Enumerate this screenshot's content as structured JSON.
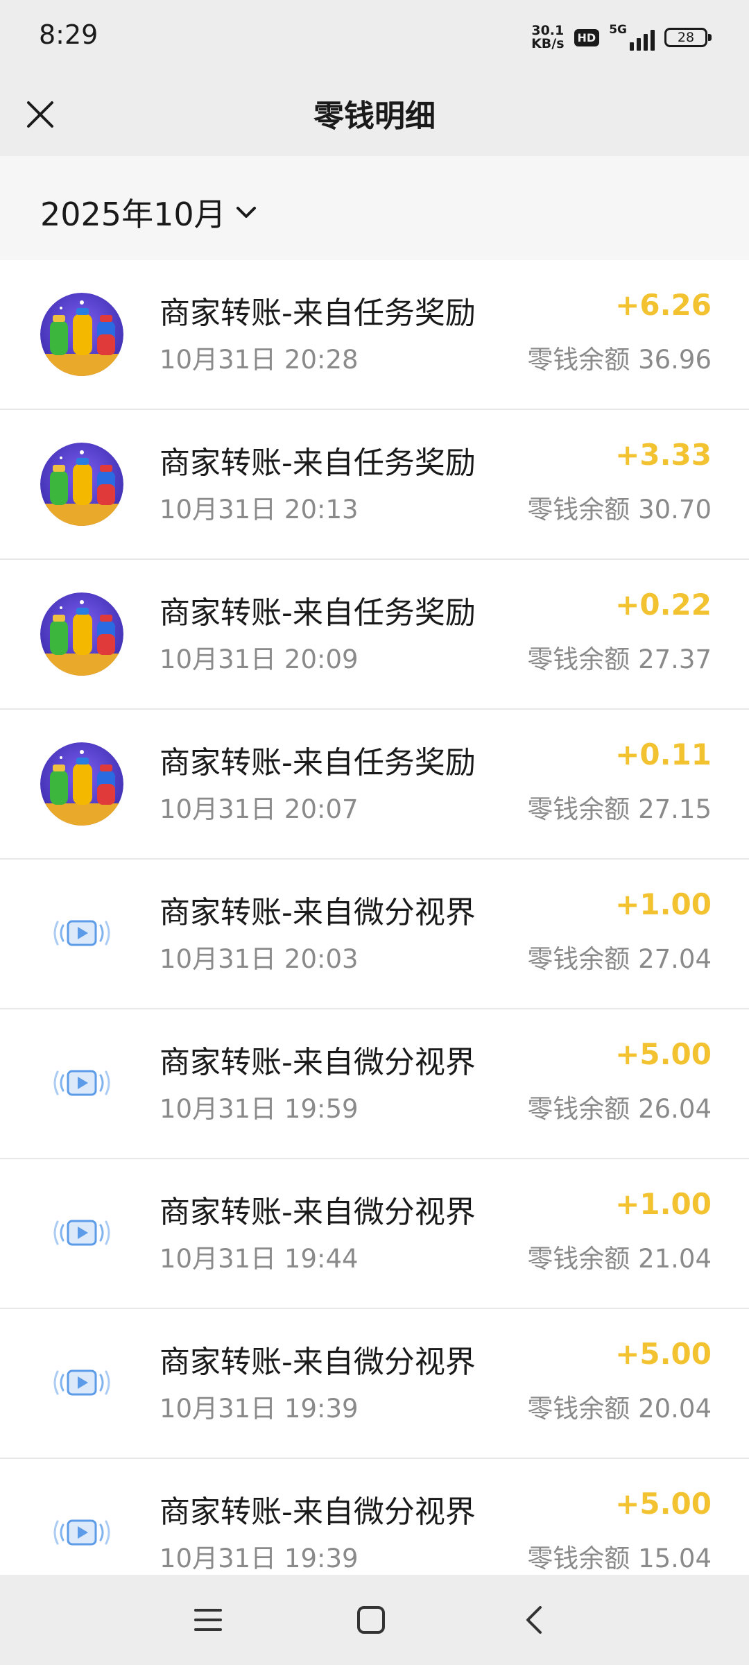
{
  "status_bar": {
    "time": "8:29",
    "net_speed_value": "30.1",
    "net_speed_unit": "KB/s",
    "hd": "HD",
    "network": "5G",
    "battery": "28"
  },
  "header": {
    "title": "零钱明细",
    "close_icon": "close-icon"
  },
  "month_selector": {
    "label": "2025年10月",
    "icon": "chevron-down-icon"
  },
  "colors": {
    "amount": "#f2c230",
    "secondary_text": "#8a8a8a",
    "background": "#ededed"
  },
  "transactions": [
    {
      "icon": "game-bottles-icon",
      "title": "商家转账-来自任务奖励",
      "date": "10月31日 20:28",
      "amount": "+6.26",
      "balance": "零钱余额 36.96"
    },
    {
      "icon": "game-bottles-icon",
      "title": "商家转账-来自任务奖励",
      "date": "10月31日 20:13",
      "amount": "+3.33",
      "balance": "零钱余额 30.70"
    },
    {
      "icon": "game-bottles-icon",
      "title": "商家转账-来自任务奖励",
      "date": "10月31日 20:09",
      "amount": "+0.22",
      "balance": "零钱余额 27.37"
    },
    {
      "icon": "game-bottles-icon",
      "title": "商家转账-来自任务奖励",
      "date": "10月31日 20:07",
      "amount": "+0.11",
      "balance": "零钱余额 27.15"
    },
    {
      "icon": "video-play-icon",
      "title": "商家转账-来自微分视界",
      "date": "10月31日 20:03",
      "amount": "+1.00",
      "balance": "零钱余额 27.04"
    },
    {
      "icon": "video-play-icon",
      "title": "商家转账-来自微分视界",
      "date": "10月31日 19:59",
      "amount": "+5.00",
      "balance": "零钱余额 26.04"
    },
    {
      "icon": "video-play-icon",
      "title": "商家转账-来自微分视界",
      "date": "10月31日 19:44",
      "amount": "+1.00",
      "balance": "零钱余额 21.04"
    },
    {
      "icon": "video-play-icon",
      "title": "商家转账-来自微分视界",
      "date": "10月31日 19:39",
      "amount": "+5.00",
      "balance": "零钱余额 20.04"
    },
    {
      "icon": "video-play-icon",
      "title": "商家转账-来自微分视界",
      "date": "10月31日 19:39",
      "amount": "+5.00",
      "balance": "零钱余额 15.04"
    }
  ],
  "bottom_nav": {
    "menu_icon": "menu-icon",
    "home_icon": "home-icon",
    "back_icon": "back-icon"
  }
}
